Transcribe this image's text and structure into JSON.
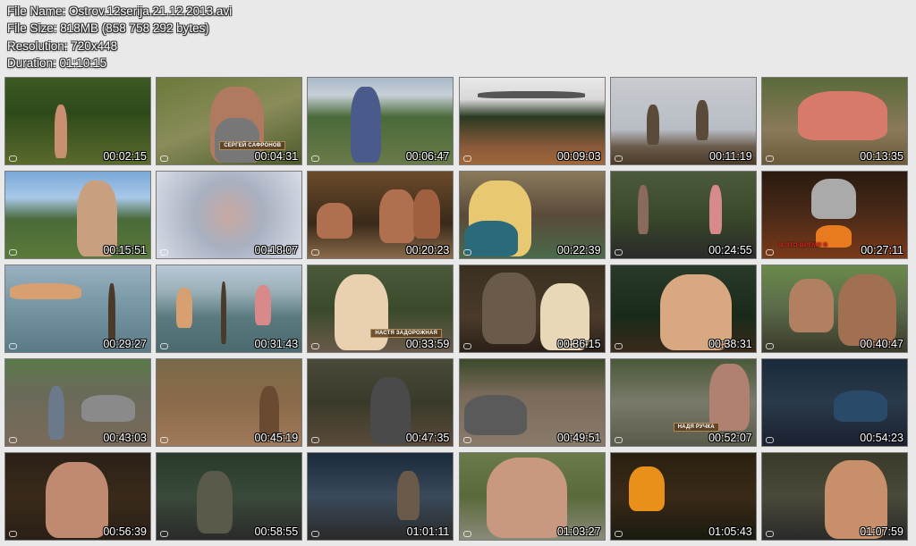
{
  "info": {
    "file_name": "File Name: Ostrov.12serija.21.12.2013.avi",
    "file_size": "File Size: 818MB (858 758 292 bytes)",
    "resolution": "Resolution: 720x448",
    "duration": "Duration: 01:10:15"
  },
  "thumbnails": [
    {
      "time": "00:02:15",
      "caption": ""
    },
    {
      "time": "00:04:31",
      "caption": "СЕРГЕЙ САФРОНОВ"
    },
    {
      "time": "00:06:47",
      "caption": ""
    },
    {
      "time": "00:09:03",
      "caption": ""
    },
    {
      "time": "00:11:19",
      "caption": ""
    },
    {
      "time": "00:13:35",
      "caption": ""
    },
    {
      "time": "00:15:51",
      "caption": ""
    },
    {
      "time": "00:18:07",
      "caption": ""
    },
    {
      "time": "00:20:23",
      "caption": ""
    },
    {
      "time": "00:22:39",
      "caption": ""
    },
    {
      "time": "00:24:55",
      "caption": ""
    },
    {
      "time": "00:27:11",
      "caption": "В ЭТО ВРЕМЯ В"
    },
    {
      "time": "00:29:27",
      "caption": ""
    },
    {
      "time": "00:31:43",
      "caption": ""
    },
    {
      "time": "00:33:59",
      "caption": "НАСТЯ ЗАДОРОЖНАЯ"
    },
    {
      "time": "00:36:15",
      "caption": ""
    },
    {
      "time": "00:38:31",
      "caption": ""
    },
    {
      "time": "00:40:47",
      "caption": ""
    },
    {
      "time": "00:43:03",
      "caption": ""
    },
    {
      "time": "00:45:19",
      "caption": ""
    },
    {
      "time": "00:47:35",
      "caption": ""
    },
    {
      "time": "00:49:51",
      "caption": ""
    },
    {
      "time": "00:52:07",
      "caption": "НАДЯ РУЧКА"
    },
    {
      "time": "00:54:23",
      "caption": ""
    },
    {
      "time": "00:56:39",
      "caption": ""
    },
    {
      "time": "00:58:55",
      "caption": ""
    },
    {
      "time": "01:01:11",
      "caption": ""
    },
    {
      "time": "01:03:27",
      "caption": ""
    },
    {
      "time": "01:05:43",
      "caption": ""
    },
    {
      "time": "01:07:59",
      "caption": ""
    }
  ]
}
